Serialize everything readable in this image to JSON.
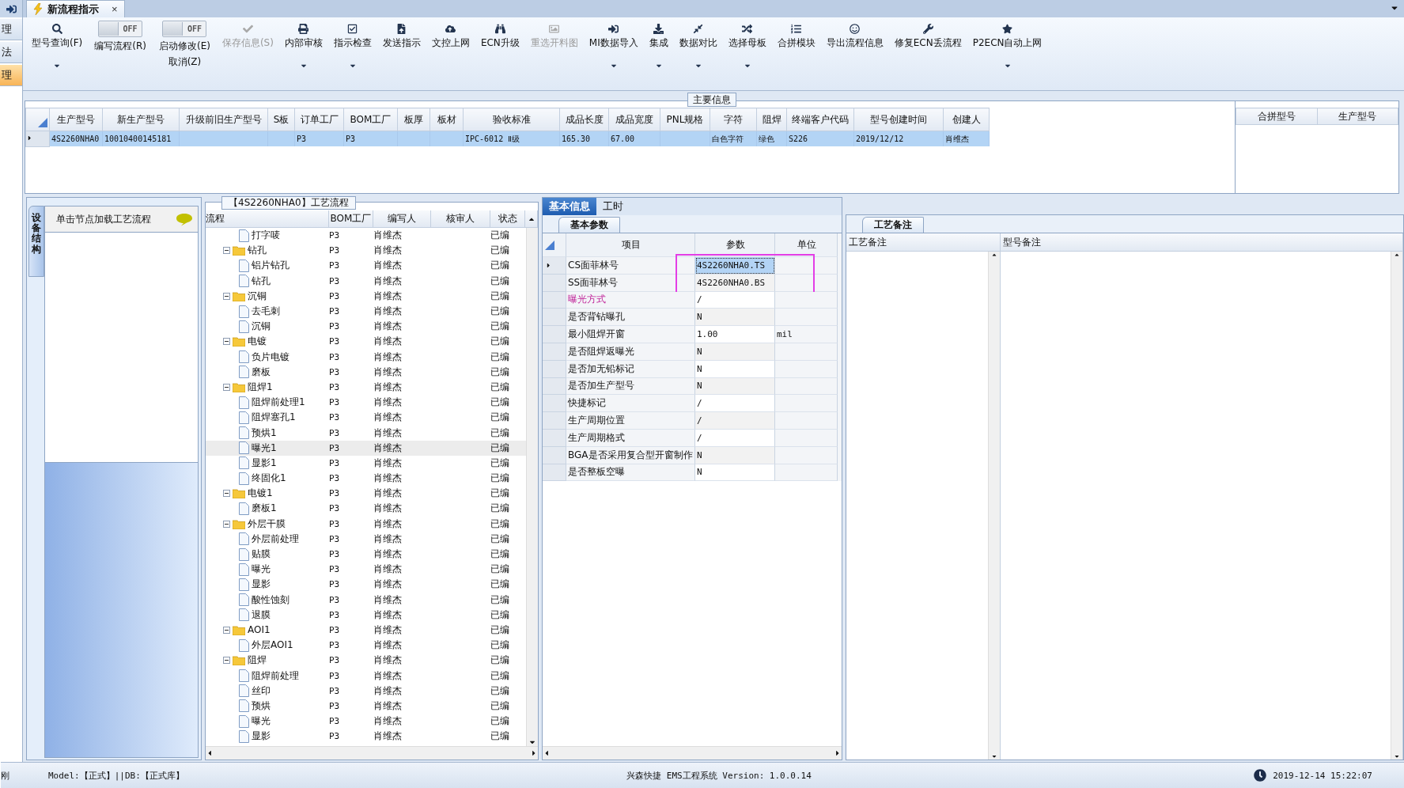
{
  "left_strip": {
    "items": [
      {
        "label": "理",
        "selected": false
      },
      {
        "label": "法",
        "selected": false
      },
      {
        "label": "理",
        "selected": true
      }
    ]
  },
  "document_tab": {
    "title": "新流程指示",
    "close": "×"
  },
  "toolbar": [
    {
      "kind": "button",
      "lines": [
        "型号查询(F)"
      ],
      "dropdown": true,
      "disabled": false
    },
    {
      "kind": "toggle",
      "lines": [
        "编写流程(R)"
      ],
      "switch_text": "OFF",
      "on": false
    },
    {
      "kind": "toggle",
      "lines": [
        "启动修改(E)",
        "取消(Z)"
      ],
      "switch_text": "OFF",
      "on": false
    },
    {
      "kind": "button",
      "lines": [
        "保存信息(S)"
      ],
      "dropdown": false,
      "disabled": true
    },
    {
      "kind": "button",
      "lines": [
        "内部审核"
      ],
      "dropdown": true,
      "disabled": false
    },
    {
      "kind": "button",
      "lines": [
        "指示检查"
      ],
      "dropdown": true,
      "disabled": false
    },
    {
      "kind": "button",
      "lines": [
        "发送指示"
      ],
      "dropdown": false,
      "disabled": false
    },
    {
      "kind": "button",
      "lines": [
        "文控上网"
      ],
      "dropdown": false,
      "disabled": false
    },
    {
      "kind": "button",
      "lines": [
        "ECN升级"
      ],
      "dropdown": false,
      "disabled": false
    },
    {
      "kind": "button",
      "lines": [
        "重选开料图"
      ],
      "dropdown": false,
      "disabled": true
    },
    {
      "kind": "button",
      "lines": [
        "MI数据导入"
      ],
      "dropdown": true,
      "disabled": false
    },
    {
      "kind": "button",
      "lines": [
        "集成"
      ],
      "dropdown": true,
      "disabled": false
    },
    {
      "kind": "button",
      "lines": [
        "数据对比"
      ],
      "dropdown": true,
      "disabled": false
    },
    {
      "kind": "button",
      "lines": [
        "选择母板"
      ],
      "dropdown": true,
      "disabled": false
    },
    {
      "kind": "button",
      "lines": [
        "合拼模块"
      ],
      "dropdown": false,
      "disabled": false
    },
    {
      "kind": "button",
      "lines": [
        "导出流程信息"
      ],
      "dropdown": false,
      "disabled": false
    },
    {
      "kind": "button",
      "lines": [
        "修复ECN丢流程"
      ],
      "dropdown": false,
      "disabled": false
    },
    {
      "kind": "button",
      "lines": [
        "P2ECN自动上网"
      ],
      "dropdown": true,
      "disabled": false
    }
  ],
  "main_info": {
    "title": "主要信息",
    "table": {
      "columns": [
        "生产型号",
        "新生产型号",
        "升级前旧生产型号",
        "S板",
        "订单工厂",
        "BOM工厂",
        "板厚",
        "板材",
        "验收标准",
        "成品长度",
        "成品宽度",
        "PNL规格",
        "字符",
        "阻焊",
        "终端客户代码",
        "型号创建时间",
        "创建人"
      ],
      "rows": [
        {
          "selected": true,
          "cells": [
            "4S2260NHA0",
            "10010400145181",
            null,
            null,
            "P3",
            "P3",
            null,
            null,
            "IPC-6012 Ⅱ级",
            "165.30",
            "67.00",
            null,
            "白色字符",
            "绿色",
            "S226",
            "2019/12/12",
            "肖维杰"
          ]
        }
      ]
    },
    "side_table": {
      "columns": [
        "合拼型号",
        "生产型号"
      ]
    }
  },
  "left_panel": {
    "vertical_tab": "设备结构",
    "hint": "单击节点加载工艺流程"
  },
  "process_tree": {
    "title": "【4S2260NHA0】工艺流程",
    "columns": [
      "流程",
      "BOM工厂",
      "编写人",
      "核审人",
      "状态"
    ],
    "items": [
      {
        "kind": "file",
        "name": "打字唛",
        "bom": "P3",
        "writer": "肖维杰",
        "status": "已编",
        "selected": false
      },
      {
        "kind": "folder",
        "name": "钻孔",
        "bom": "P3",
        "writer": "肖维杰",
        "status": "已编",
        "selected": false,
        "expanded": true,
        "children": [
          {
            "kind": "file",
            "name": "铝片钻孔",
            "bom": "P3",
            "writer": "肖维杰",
            "status": "已编",
            "selected": false
          },
          {
            "kind": "file",
            "name": "钻孔",
            "bom": "P3",
            "writer": "肖维杰",
            "status": "已编",
            "selected": false
          }
        ]
      },
      {
        "kind": "folder",
        "name": "沉铜",
        "bom": "P3",
        "writer": "肖维杰",
        "status": "已编",
        "selected": false,
        "expanded": true,
        "children": [
          {
            "kind": "file",
            "name": "去毛刺",
            "bom": "P3",
            "writer": "肖维杰",
            "status": "已编",
            "selected": false
          },
          {
            "kind": "file",
            "name": "沉铜",
            "bom": "P3",
            "writer": "肖维杰",
            "status": "已编",
            "selected": false
          }
        ]
      },
      {
        "kind": "folder",
        "name": "电镀",
        "bom": "P3",
        "writer": "肖维杰",
        "status": "已编",
        "selected": false,
        "expanded": true,
        "children": [
          {
            "kind": "file",
            "name": "负片电镀",
            "bom": "P3",
            "writer": "肖维杰",
            "status": "已编",
            "selected": false
          },
          {
            "kind": "file",
            "name": "磨板",
            "bom": "P3",
            "writer": "肖维杰",
            "status": "已编",
            "selected": false
          }
        ]
      },
      {
        "kind": "folder",
        "name": "阻焊1",
        "bom": "P3",
        "writer": "肖维杰",
        "status": "已编",
        "selected": false,
        "expanded": true,
        "children": [
          {
            "kind": "file",
            "name": "阻焊前处理1",
            "bom": "P3",
            "writer": "肖维杰",
            "status": "已编",
            "selected": false
          },
          {
            "kind": "file",
            "name": "阻焊塞孔1",
            "bom": "P3",
            "writer": "肖维杰",
            "status": "已编",
            "selected": false
          },
          {
            "kind": "file",
            "name": "预烘1",
            "bom": "P3",
            "writer": "肖维杰",
            "status": "已编",
            "selected": false
          },
          {
            "kind": "file",
            "name": "曝光1",
            "bom": "P3",
            "writer": "肖维杰",
            "status": "已编",
            "selected": true
          },
          {
            "kind": "file",
            "name": "显影1",
            "bom": "P3",
            "writer": "肖维杰",
            "status": "已编",
            "selected": false
          },
          {
            "kind": "file",
            "name": "终固化1",
            "bom": "P3",
            "writer": "肖维杰",
            "status": "已编",
            "selected": false
          }
        ]
      },
      {
        "kind": "folder",
        "name": "电镀1",
        "bom": "P3",
        "writer": "肖维杰",
        "status": "已编",
        "selected": false,
        "expanded": true,
        "children": [
          {
            "kind": "file",
            "name": "磨板1",
            "bom": "P3",
            "writer": "肖维杰",
            "status": "已编",
            "selected": false
          }
        ]
      },
      {
        "kind": "folder",
        "name": "外层干膜",
        "bom": "P3",
        "writer": "肖维杰",
        "status": "已编",
        "selected": false,
        "expanded": true,
        "children": [
          {
            "kind": "file",
            "name": "外层前处理",
            "bom": "P3",
            "writer": "肖维杰",
            "status": "已编",
            "selected": false
          },
          {
            "kind": "file",
            "name": "贴膜",
            "bom": "P3",
            "writer": "肖维杰",
            "status": "已编",
            "selected": false
          },
          {
            "kind": "file",
            "name": "曝光",
            "bom": "P3",
            "writer": "肖维杰",
            "status": "已编",
            "selected": false
          },
          {
            "kind": "file",
            "name": "显影",
            "bom": "P3",
            "writer": "肖维杰",
            "status": "已编",
            "selected": false
          },
          {
            "kind": "file",
            "name": "酸性蚀刻",
            "bom": "P3",
            "writer": "肖维杰",
            "status": "已编",
            "selected": false
          },
          {
            "kind": "file",
            "name": "退膜",
            "bom": "P3",
            "writer": "肖维杰",
            "status": "已编",
            "selected": false
          }
        ]
      },
      {
        "kind": "folder",
        "name": "AOI1",
        "bom": "P3",
        "writer": "肖维杰",
        "status": "已编",
        "selected": false,
        "expanded": true,
        "children": [
          {
            "kind": "file",
            "name": "外层AOI1",
            "bom": "P3",
            "writer": "肖维杰",
            "status": "已编",
            "selected": false
          }
        ]
      },
      {
        "kind": "folder",
        "name": "阻焊",
        "bom": "P3",
        "writer": "肖维杰",
        "status": "已编",
        "selected": false,
        "expanded": true,
        "children": [
          {
            "kind": "file",
            "name": "阻焊前处理",
            "bom": "P3",
            "writer": "肖维杰",
            "status": "已编",
            "selected": false
          },
          {
            "kind": "file",
            "name": "丝印",
            "bom": "P3",
            "writer": "肖维杰",
            "status": "已编",
            "selected": false
          },
          {
            "kind": "file",
            "name": "预烘",
            "bom": "P3",
            "writer": "肖维杰",
            "status": "已编",
            "selected": false
          },
          {
            "kind": "file",
            "name": "曝光",
            "bom": "P3",
            "writer": "肖维杰",
            "status": "已编",
            "selected": false
          },
          {
            "kind": "file",
            "name": "显影",
            "bom": "P3",
            "writer": "肖维杰",
            "status": "已编",
            "selected": false
          }
        ]
      }
    ]
  },
  "info_tabs": [
    {
      "label": "基本信息",
      "selected": true
    },
    {
      "label": "工时",
      "selected": false
    }
  ],
  "params": {
    "tab": "基本参数",
    "columns": [
      "项目",
      "参数",
      "单位"
    ],
    "rows": [
      {
        "item": "CS面菲林号",
        "value": "4S2260NHA0.TS",
        "selected": true,
        "marked": true,
        "highlighted": false
      },
      {
        "item": "SS面菲林号",
        "value": "4S2260NHA0.BS",
        "selected": false,
        "marked": true,
        "highlighted": false
      },
      {
        "item": "曝光方式",
        "value": "/",
        "selected": false,
        "marked": false,
        "highlighted": true
      },
      {
        "item": "是否背钻曝孔",
        "value": "N",
        "selected": false,
        "marked": false,
        "highlighted": false
      },
      {
        "item": "最小阻焊开窗",
        "value": "1.00",
        "unit": "mil",
        "selected": false,
        "marked": false,
        "highlighted": false
      },
      {
        "item": "是否阻焊返曝光",
        "value": "N",
        "selected": false,
        "marked": false,
        "highlighted": false
      },
      {
        "item": "是否加无铅标记",
        "value": "N",
        "selected": false,
        "marked": false,
        "highlighted": false
      },
      {
        "item": "是否加生产型号",
        "value": "N",
        "selected": false,
        "marked": false,
        "highlighted": false
      },
      {
        "item": "快捷标记",
        "value": "/",
        "selected": false,
        "marked": false,
        "highlighted": false
      },
      {
        "item": "生产周期位置",
        "value": "/",
        "selected": false,
        "marked": false,
        "highlighted": false
      },
      {
        "item": "生产周期格式",
        "value": "/",
        "selected": false,
        "marked": false,
        "highlighted": false
      },
      {
        "item": "BGA是否采用复合型开窗制作",
        "value": "N",
        "selected": false,
        "marked": false,
        "highlighted": false
      },
      {
        "item": "是否整板空曝",
        "value": "N",
        "selected": false,
        "marked": false,
        "highlighted": false
      }
    ]
  },
  "notes": {
    "tab": "工艺备注",
    "columns": [
      "工艺备注",
      "型号备注"
    ]
  },
  "status_bar": {
    "left_cut": "刚",
    "model": "Model:【正式】||DB:【正式库】",
    "system": "兴森快捷 EMS工程系统 Version: 1.0.0.14",
    "datetime": "2019-12-14 15:22:07"
  }
}
